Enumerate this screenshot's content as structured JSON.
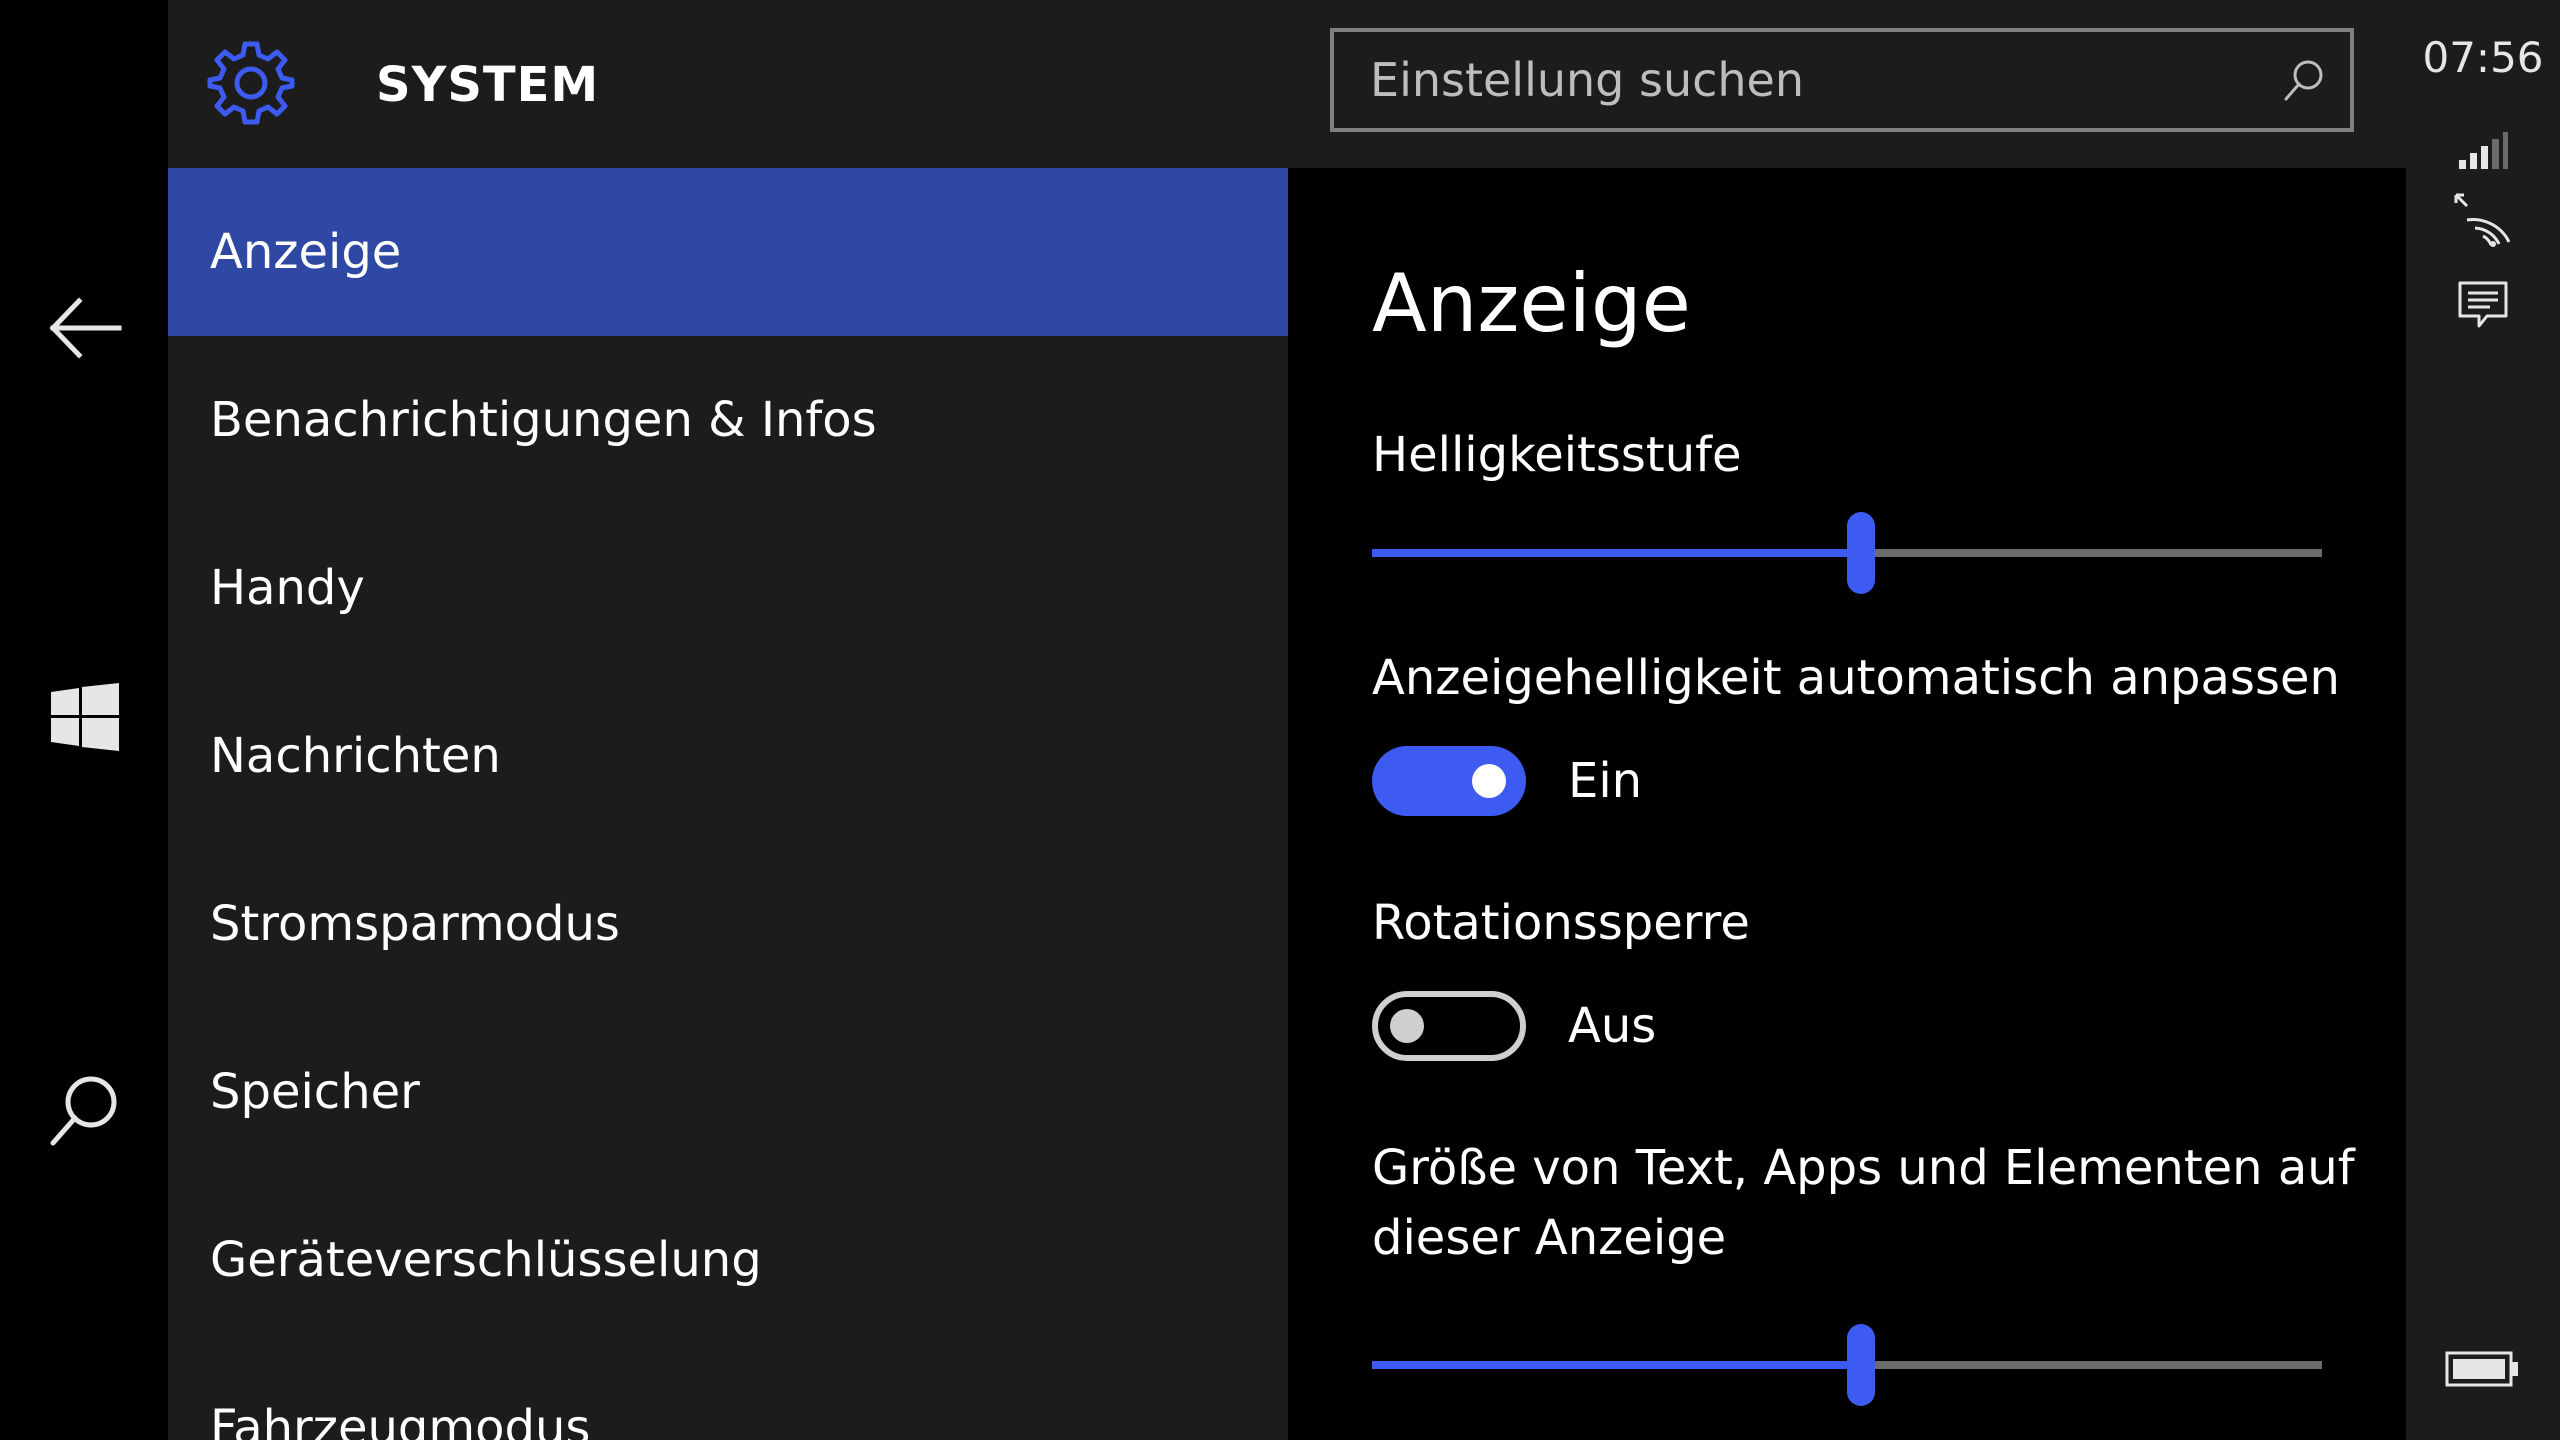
{
  "header": {
    "title": "SYSTEM",
    "icon": "gear-icon",
    "accent_color": "#3d5af1"
  },
  "search": {
    "placeholder": "Einstellung suchen",
    "value": ""
  },
  "sidebar": {
    "items": [
      {
        "label": "Anzeige",
        "active": true
      },
      {
        "label": "Benachrichtigungen & Infos",
        "active": false
      },
      {
        "label": "Handy",
        "active": false
      },
      {
        "label": "Nachrichten",
        "active": false
      },
      {
        "label": "Stromsparmodus",
        "active": false
      },
      {
        "label": "Speicher",
        "active": false
      },
      {
        "label": "Geräteverschlüsselung",
        "active": false
      },
      {
        "label": "Fahrzeugmodus",
        "active": false
      }
    ],
    "active_color": "#2f48a3"
  },
  "content": {
    "title": "Anzeige",
    "brightness": {
      "label": "Helligkeitsstufe",
      "value_fraction": 0.515
    },
    "auto_brightness": {
      "label": "Anzeigehelligkeit automatisch anpassen",
      "state": "Ein",
      "on": true
    },
    "rotation_lock": {
      "label": "Rotationssperre",
      "state": "Aus",
      "on": false
    },
    "scaling": {
      "label_line1": "Größe von Text, Apps und Elementen auf",
      "label_line2": "dieser Anzeige",
      "value_fraction": 0.515
    }
  },
  "navbar": {
    "icons": [
      "back-arrow-icon",
      "windows-logo-icon",
      "search-icon"
    ]
  },
  "status": {
    "time": "07:56",
    "icons": [
      "signal-bars-icon",
      "wifi-icon",
      "notifications-icon",
      "battery-icon"
    ]
  }
}
